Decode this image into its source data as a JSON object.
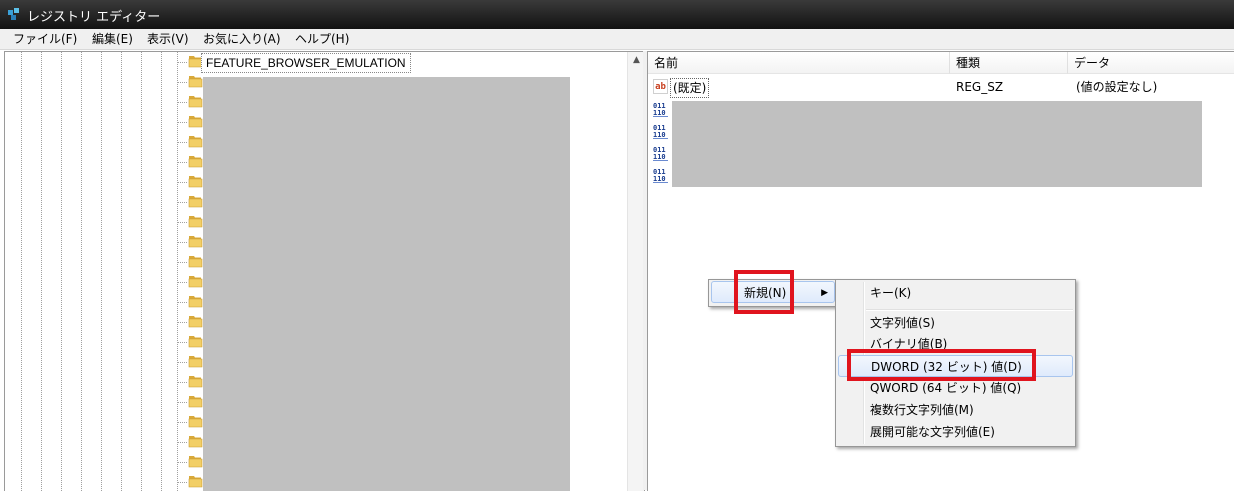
{
  "window": {
    "title": "レジストリ エディター",
    "icon": "regedit-icon"
  },
  "menubar": {
    "items": [
      "ファイル(F)",
      "編集(E)",
      "表示(V)",
      "お気に入り(A)",
      "ヘルプ(H)"
    ]
  },
  "tree": {
    "selected_key": "FEATURE_BROWSER_EMULATION",
    "folder_icon": "folder-icon",
    "scroll_up": "▲"
  },
  "values_list": {
    "columns": [
      "名前",
      "種類",
      "データ"
    ],
    "rows": [
      {
        "name": "(既定)",
        "type": "REG_SZ",
        "data": "(値の設定なし)",
        "icon": "string-value-icon"
      },
      {
        "icon": "binary-value-icon",
        "redacted": true
      },
      {
        "icon": "binary-value-icon",
        "redacted": true
      },
      {
        "icon": "binary-value-icon",
        "redacted": true
      },
      {
        "icon": "binary-value-icon",
        "redacted": true
      }
    ]
  },
  "context_menu": {
    "new_label": "新規(N)",
    "arrow": "▶"
  },
  "submenu": {
    "key": "キー(K)",
    "string_value": "文字列値(S)",
    "binary_value": "バイナリ値(B)",
    "dword_value": "DWORD (32 ビット) 値(D)",
    "qword_value": "QWORD (64 ビット) 値(Q)",
    "multi_string_value": "複数行文字列値(M)",
    "expandable_string_value": "展開可能な文字列値(E)"
  },
  "colors": {
    "highlight_box": "#e0141e",
    "redaction": "#c0c0c0",
    "titlebar": "#1e1e1e"
  }
}
